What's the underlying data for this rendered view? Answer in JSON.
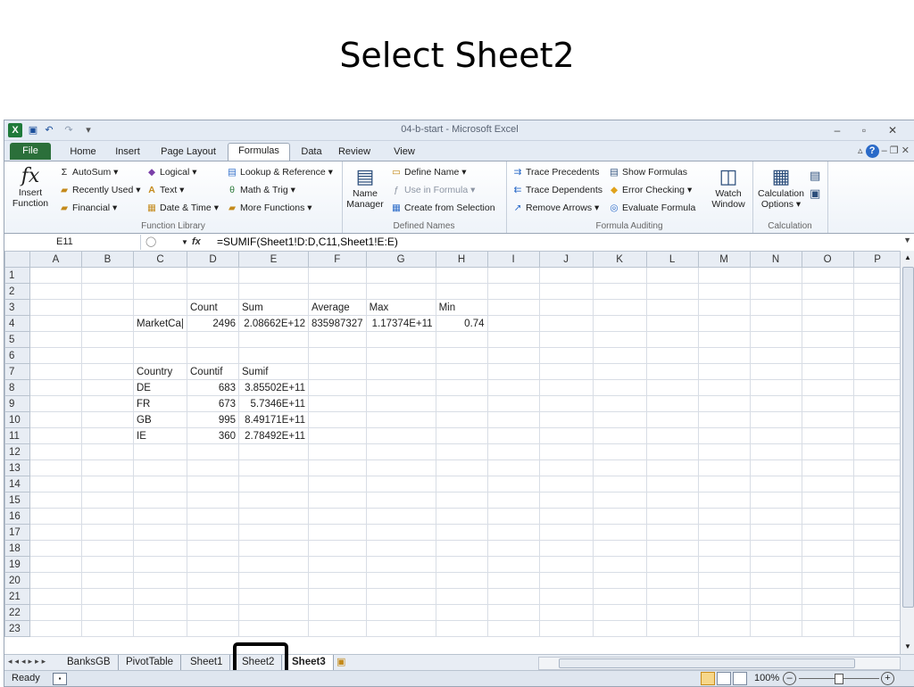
{
  "slide": {
    "title": "Select Sheet2"
  },
  "window": {
    "title": "04-b-start - Microsoft Excel"
  },
  "tabs": [
    "File",
    "Home",
    "Insert",
    "Page Layout",
    "Formulas",
    "Data",
    "Review",
    "View"
  ],
  "ribbon": {
    "insert_function": {
      "line1": "Insert",
      "line2": "Function"
    },
    "autosum": "AutoSum ▾",
    "recently_used": "Recently Used ▾",
    "financial": "Financial ▾",
    "logical": "Logical ▾",
    "text": "Text ▾",
    "date_time": "Date & Time ▾",
    "lookup": "Lookup & Reference ▾",
    "math_trig": "Math & Trig ▾",
    "more_functions": "More Functions ▾",
    "function_library_label": "Function Library",
    "name_manager": {
      "line1": "Name",
      "line2": "Manager"
    },
    "define_name": "Define Name ▾",
    "use_in_formula": "Use in Formula ▾",
    "create_from_selection": "Create from Selection",
    "defined_names_label": "Defined Names",
    "trace_precedents": "Trace Precedents",
    "trace_dependents": "Trace Dependents",
    "remove_arrows": "Remove Arrows ▾",
    "show_formulas": "Show Formulas",
    "error_checking": "Error Checking ▾",
    "evaluate_formula": "Evaluate Formula",
    "watch_window": {
      "line1": "Watch",
      "line2": "Window"
    },
    "formula_auditing_label": "Formula Auditing",
    "calc_options": {
      "line1": "Calculation",
      "line2": "Options ▾"
    },
    "calculation_label": "Calculation"
  },
  "formula_bar": {
    "cell_ref": "E11",
    "fx": "fx",
    "formula": "=SUMIF(Sheet1!D:D,C11,Sheet1!E:E)"
  },
  "columns": [
    "A",
    "B",
    "C",
    "D",
    "E",
    "F",
    "G",
    "H",
    "I",
    "J",
    "K",
    "L",
    "M",
    "N",
    "O",
    "P"
  ],
  "rows": [
    [
      "",
      "",
      "",
      "",
      "",
      "",
      "",
      ""
    ],
    [
      "",
      "",
      "",
      "",
      "",
      "",
      "",
      ""
    ],
    [
      "",
      "",
      "",
      "Count",
      "Sum",
      "Average",
      "Max",
      "Min"
    ],
    [
      "",
      "",
      "MarketCa|",
      "2496",
      "2.08662E+12",
      "835987327",
      "1.17374E+11",
      "0.74"
    ],
    [
      "",
      "",
      "",
      "",
      "",
      "",
      "",
      ""
    ],
    [
      "",
      "",
      "",
      "",
      "",
      "",
      "",
      ""
    ],
    [
      "",
      "",
      "Country",
      "Countif",
      "Sumif",
      "",
      "",
      ""
    ],
    [
      "",
      "",
      "DE",
      "683",
      "3.85502E+11",
      "",
      "",
      ""
    ],
    [
      "",
      "",
      "FR",
      "673",
      "5.7346E+11",
      "",
      "",
      ""
    ],
    [
      "",
      "",
      "GB",
      "995",
      "8.49171E+11",
      "",
      "",
      ""
    ],
    [
      "",
      "",
      "IE",
      "360",
      "2.78492E+11",
      "",
      "",
      ""
    ],
    [
      "",
      "",
      "",
      "",
      "",
      "",
      "",
      ""
    ],
    [
      "",
      "",
      "",
      "",
      "",
      "",
      "",
      ""
    ],
    [
      "",
      "",
      "",
      "",
      "",
      "",
      "",
      ""
    ],
    [
      "",
      "",
      "",
      "",
      "",
      "",
      "",
      ""
    ],
    [
      "",
      "",
      "",
      "",
      "",
      "",
      "",
      ""
    ],
    [
      "",
      "",
      "",
      "",
      "",
      "",
      "",
      ""
    ],
    [
      "",
      "",
      "",
      "",
      "",
      "",
      "",
      ""
    ],
    [
      "",
      "",
      "",
      "",
      "",
      "",
      "",
      ""
    ],
    [
      "",
      "",
      "",
      "",
      "",
      "",
      "",
      ""
    ],
    [
      "",
      "",
      "",
      "",
      "",
      "",
      "",
      ""
    ],
    [
      "",
      "",
      "",
      "",
      "",
      "",
      "",
      ""
    ],
    [
      "",
      "",
      "",
      "",
      "",
      "",
      "",
      ""
    ]
  ],
  "sheet_tabs": [
    "BanksGB",
    "PivotTable",
    "Sheet1",
    "Sheet2",
    "Sheet3"
  ],
  "active_sheet": "Sheet3",
  "status": {
    "text": "Ready",
    "zoom": "100%"
  }
}
